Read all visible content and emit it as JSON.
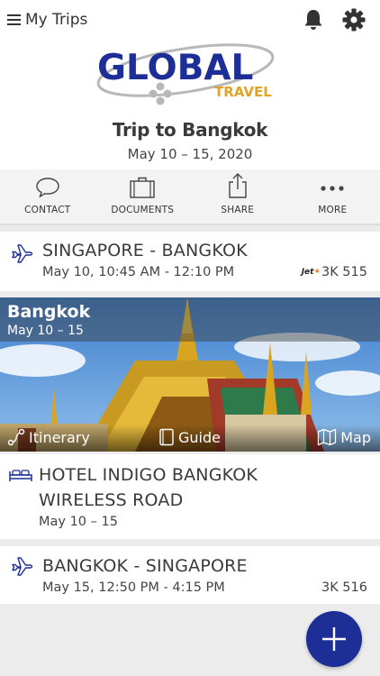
{
  "topbar": {
    "menu_label": "My Trips",
    "icons": [
      "menu-icon",
      "bell-icon",
      "gear-icon"
    ]
  },
  "logo": {
    "word1": "GLOBAL",
    "word2": "TRAVEL",
    "colors": {
      "primary": "#1d2f96",
      "accent": "#e0a526"
    }
  },
  "trip": {
    "title": "Trip to Bangkok",
    "dates": "May 10 – 15, 2020"
  },
  "actions": [
    {
      "label": "CONTACT",
      "icon": "chat-bubble-icon"
    },
    {
      "label": "DOCUMENTS",
      "icon": "briefcase-icon"
    },
    {
      "label": "SHARE",
      "icon": "share-icon"
    },
    {
      "label": "MORE",
      "icon": "more-dots-icon"
    }
  ],
  "segments": {
    "flight1": {
      "route": "SINGAPORE - BANGKOK",
      "time": "May 10, 10:45 AM - 12:10 PM",
      "airline_logo": "Jet",
      "flight_code": "3K 515"
    },
    "destination": {
      "name": "Bangkok",
      "dates": "May 10 – 15",
      "links": [
        "Itinerary",
        "Guide",
        "Map"
      ]
    },
    "hotel": {
      "name_line1": "HOTEL INDIGO BANGKOK",
      "name_line2": "WIRELESS ROAD",
      "dates": "May 10 – 15"
    },
    "flight2": {
      "route": "BANGKOK - SINGAPORE",
      "time": "May 15, 12:50 PM - 4:15 PM",
      "flight_code": "3K 516"
    }
  },
  "fab": {
    "icon": "plus-icon"
  }
}
